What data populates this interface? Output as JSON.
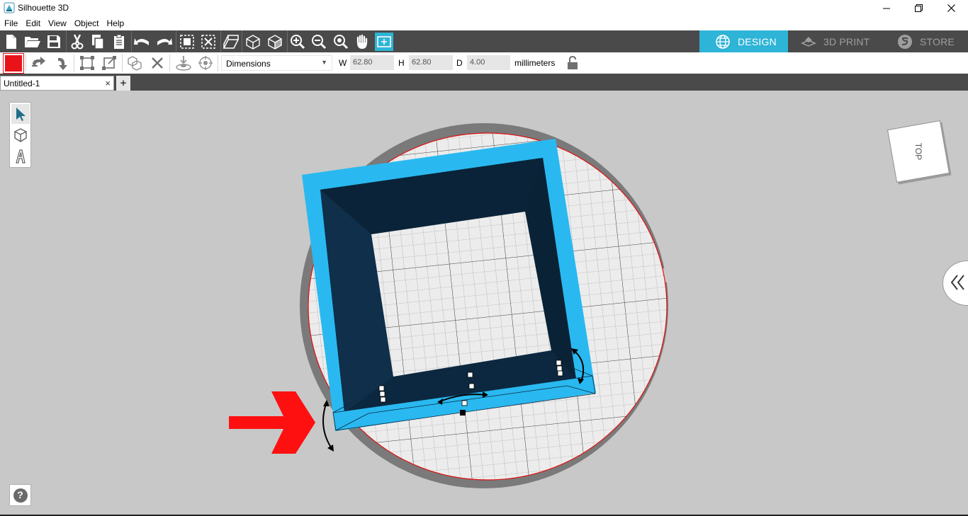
{
  "app": {
    "title": "Silhouette 3D"
  },
  "menu": [
    "File",
    "Edit",
    "View",
    "Object",
    "Help"
  ],
  "modes": {
    "design": "DESIGN",
    "print": "3D PRINT",
    "store": "STORE",
    "active": "design",
    "accent": "#2eb4d6"
  },
  "toolbar": {
    "icons": [
      "new-file-icon",
      "open-folder-icon",
      "save-icon",
      "cut-icon",
      "copy-icon",
      "paste-icon",
      "undo-icon",
      "redo-icon",
      "group-icon",
      "ungroup-icon",
      "extrude-icon",
      "cube-wireframe-icon",
      "cube-solid-icon",
      "zoom-in-icon",
      "zoom-out-icon",
      "zoom-fit-icon",
      "pan-hand-icon",
      "fit-to-view-icon"
    ]
  },
  "properties": {
    "color": "#e8141a",
    "mode_select": "Dimensions",
    "w_label": "W",
    "w_value": "62.80",
    "h_label": "H",
    "h_value": "62.80",
    "d_label": "D",
    "d_value": "4.00",
    "units": "millimeters"
  },
  "tabs": [
    {
      "label": "Untitled-1",
      "close": "×"
    }
  ],
  "tab_add": "+",
  "viewcube": {
    "face": "TOP"
  },
  "help": {
    "label": "?"
  },
  "model": {
    "frame_color": "#29b9f0",
    "inner_color": "#0c2840",
    "bed_ring_color": "#7a7a7a",
    "bed_edge_color": "#e01010",
    "annotation_arrow_color": "#ff1010"
  }
}
